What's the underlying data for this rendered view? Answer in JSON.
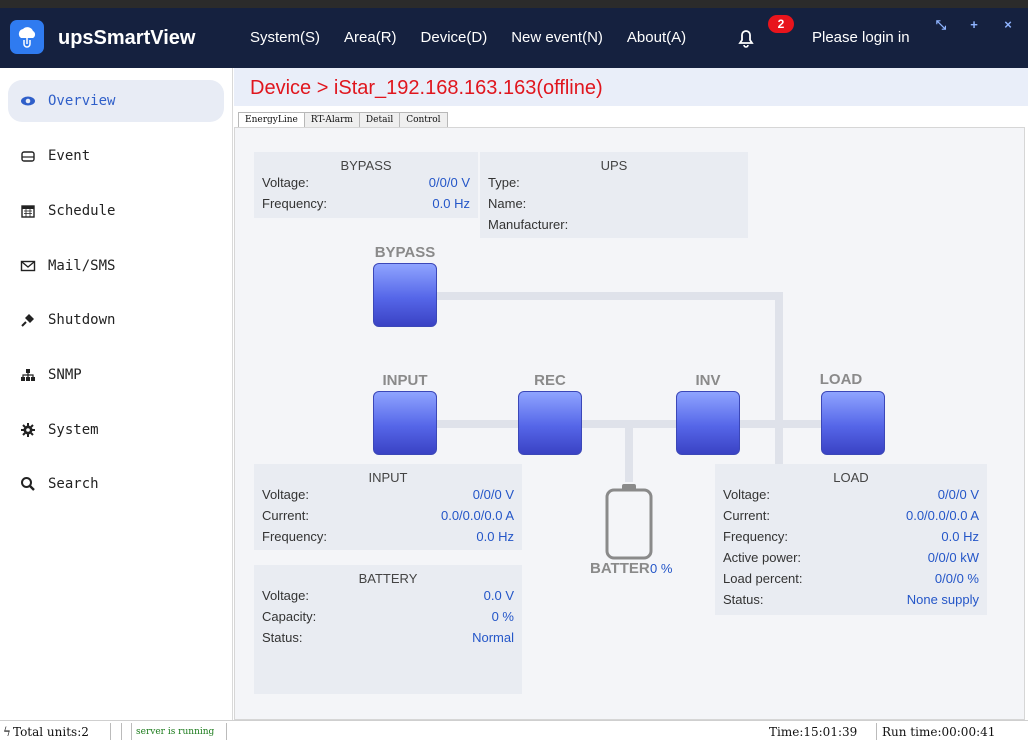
{
  "app": {
    "name": "upsSmartView",
    "login_text": "Please login in",
    "notification_count": "2"
  },
  "menu": [
    "System(S)",
    "Area(R)",
    "Device(D)",
    "New event(N)",
    "About(A)"
  ],
  "sidebar": {
    "items": [
      {
        "label": "Overview",
        "icon": "eye-icon",
        "active": true
      },
      {
        "label": "Event",
        "icon": "drive-icon"
      },
      {
        "label": "Schedule",
        "icon": "calendar-icon"
      },
      {
        "label": "Mail/SMS",
        "icon": "envelope-icon"
      },
      {
        "label": "Shutdown",
        "icon": "plug-icon"
      },
      {
        "label": "SNMP",
        "icon": "network-icon"
      },
      {
        "label": "System",
        "icon": "gear-icon"
      },
      {
        "label": "Search",
        "icon": "search-icon"
      }
    ]
  },
  "page": {
    "title": "Device > iStar_192.168.163.163(offline)",
    "tabs": [
      "EnergyLine",
      "RT-Alarm",
      "Detail",
      "Control"
    ]
  },
  "bypass_box": {
    "title": "BYPASS",
    "rows": [
      {
        "k": "Voltage:",
        "v": "0/0/0 V"
      },
      {
        "k": "Frequency:",
        "v": "0.0 Hz"
      }
    ]
  },
  "ups_box": {
    "title": "UPS",
    "rows": [
      {
        "k": "Type:",
        "v": ""
      },
      {
        "k": "Name:",
        "v": ""
      },
      {
        "k": "Manufacturer:",
        "v": ""
      }
    ]
  },
  "input_box": {
    "title": "INPUT",
    "rows": [
      {
        "k": "Voltage:",
        "v": "0/0/0 V"
      },
      {
        "k": "Current:",
        "v": "0.0/0.0/0.0 A"
      },
      {
        "k": "Frequency:",
        "v": "0.0 Hz"
      }
    ]
  },
  "battery_box": {
    "title": "BATTERY",
    "rows": [
      {
        "k": "Voltage:",
        "v": "0.0 V"
      },
      {
        "k": "Capacity:",
        "v": "0 %"
      },
      {
        "k": "Status:",
        "v": "Normal"
      }
    ]
  },
  "load_box": {
    "title": "LOAD",
    "rows": [
      {
        "k": "Voltage:",
        "v": "0/0/0 V"
      },
      {
        "k": "Current:",
        "v": "0.0/0.0/0.0 A"
      },
      {
        "k": "Frequency:",
        "v": "0.0 Hz"
      },
      {
        "k": "Active power:",
        "v": "0/0/0 kW"
      },
      {
        "k": "Load percent:",
        "v": "0/0/0 %"
      },
      {
        "k": "Status:",
        "v": "None supply"
      }
    ]
  },
  "diagram": {
    "bypass": "BYPASS",
    "input": "INPUT",
    "rec": "REC",
    "inv": "INV",
    "load": "LOAD",
    "battery": "BATTER",
    "battery_percent": "0 %"
  },
  "status": {
    "units": "Total units:2",
    "server": "server is running",
    "time": "Time:15:01:39",
    "runtime": "Run time:00:00:41"
  },
  "colors": {
    "header": "#15213f",
    "accent": "#2f5fc9",
    "title": "#e0161e",
    "value": "#2456c8"
  }
}
